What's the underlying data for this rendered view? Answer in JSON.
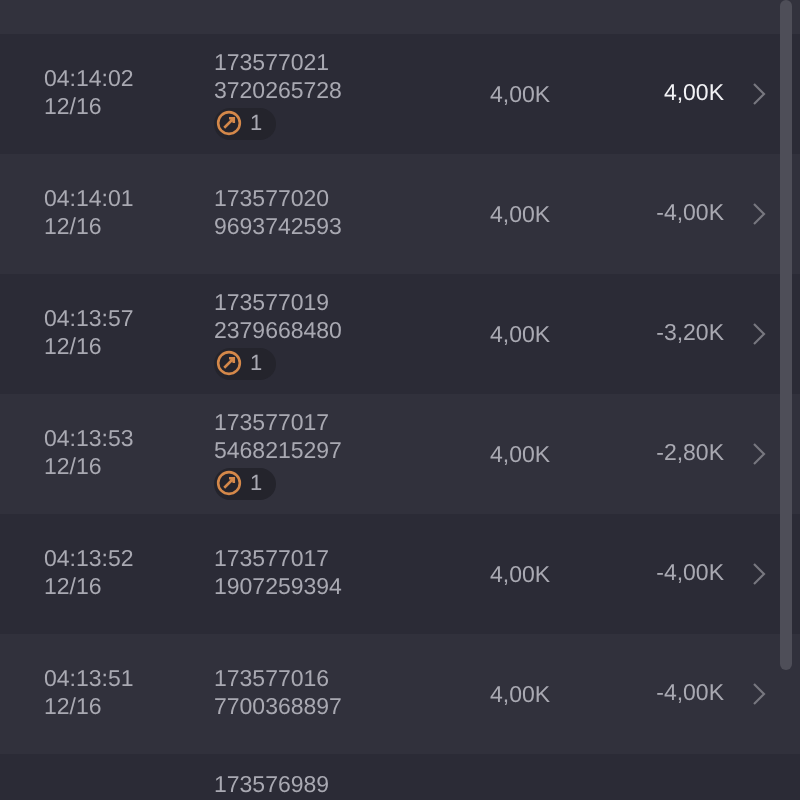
{
  "rows": [
    {
      "time": "04:14:02",
      "date": "12/16",
      "id_line1": "173577021",
      "id_line2": "3720265728",
      "badge": "1",
      "amount": "4,00K",
      "result": "4,00K",
      "emphasized": true
    },
    {
      "time": "04:14:01",
      "date": "12/16",
      "id_line1": "173577020",
      "id_line2": "9693742593",
      "amount": "4,00K",
      "result": "-4,00K",
      "emphasized": false
    },
    {
      "time": "04:13:57",
      "date": "12/16",
      "id_line1": "173577019",
      "id_line2": "2379668480",
      "badge": "1",
      "amount": "4,00K",
      "result": "-3,20K",
      "emphasized": false
    },
    {
      "time": "04:13:53",
      "date": "12/16",
      "id_line1": "173577017",
      "id_line2": "5468215297",
      "badge": "1",
      "amount": "4,00K",
      "result": "-2,80K",
      "emphasized": false
    },
    {
      "time": "04:13:52",
      "date": "12/16",
      "id_line1": "173577017",
      "id_line2": "1907259394",
      "amount": "4,00K",
      "result": "-4,00K",
      "emphasized": false
    },
    {
      "time": "04:13:51",
      "date": "12/16",
      "id_line1": "173577016",
      "id_line2": "7700368897",
      "amount": "4,00K",
      "result": "-4,00K",
      "emphasized": false
    },
    {
      "id_line1": "173576989"
    }
  ]
}
